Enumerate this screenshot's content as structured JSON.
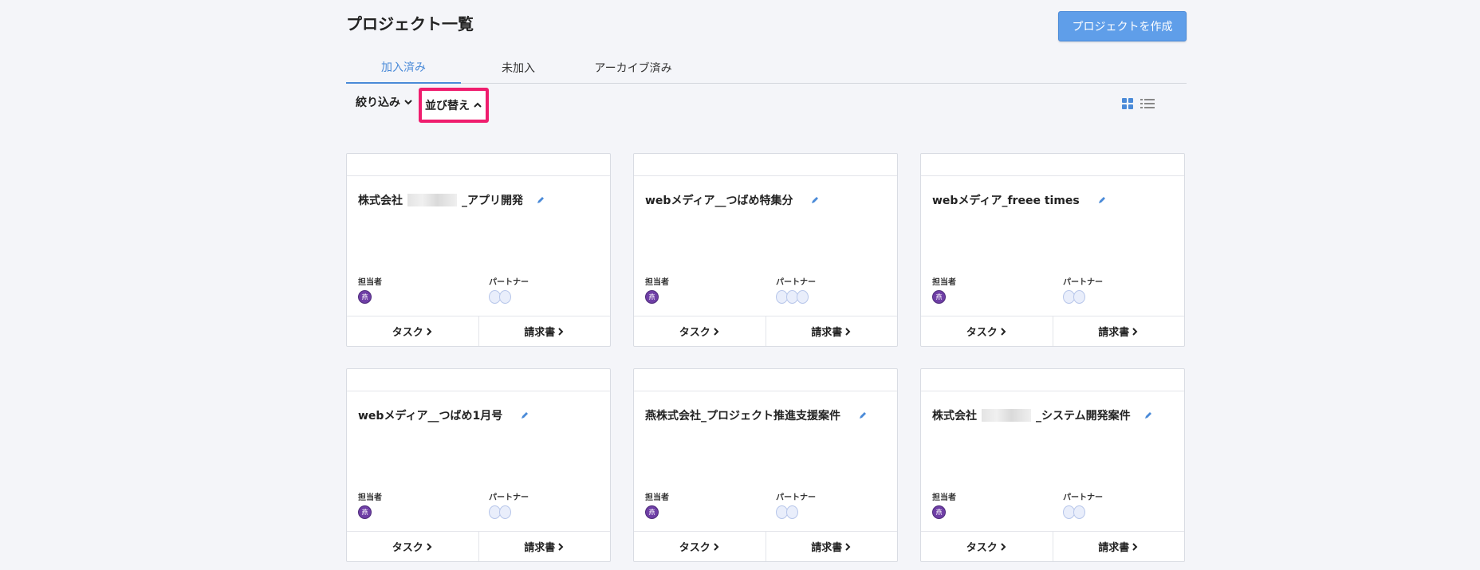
{
  "page": {
    "title": "プロジェクト一覧",
    "create_button": "プロジェクトを作成"
  },
  "tabs": [
    {
      "label": "加入済み",
      "active": true
    },
    {
      "label": "未加入",
      "active": false
    },
    {
      "label": "アーカイブ済み",
      "active": false
    }
  ],
  "toolbar": {
    "filter_label": "絞り込み",
    "sort_label": "並び替え"
  },
  "colors": {
    "accent": "#4a8ad8",
    "highlight": "#ef1d6e",
    "owner_avatar": "#6f3fa6"
  },
  "card_labels": {
    "owner": "担当者",
    "partner": "パートナー",
    "task": "タスク",
    "invoice": "請求書"
  },
  "projects": [
    {
      "title_prefix": "株式会社",
      "title_suffix": "_アプリ開発",
      "has_blur": true,
      "owner_initial": "燕",
      "partners": 2
    },
    {
      "title_prefix": "webメディア__つばめ特集分",
      "title_suffix": "",
      "has_blur": false,
      "owner_initial": "燕",
      "partners": 3
    },
    {
      "title_prefix": "webメディア_freee times",
      "title_suffix": "",
      "has_blur": false,
      "owner_initial": "燕",
      "partners": 2
    },
    {
      "title_prefix": "webメディア__つばめ1月号",
      "title_suffix": "",
      "has_blur": false,
      "owner_initial": "燕",
      "partners": 2
    },
    {
      "title_prefix": "燕株式会社_プロジェクト推進支援案件",
      "title_suffix": "",
      "has_blur": false,
      "owner_initial": "燕",
      "partners": 2
    },
    {
      "title_prefix": "株式会社",
      "title_suffix": "_システム開発案件",
      "has_blur": true,
      "owner_initial": "燕",
      "partners": 2
    }
  ]
}
